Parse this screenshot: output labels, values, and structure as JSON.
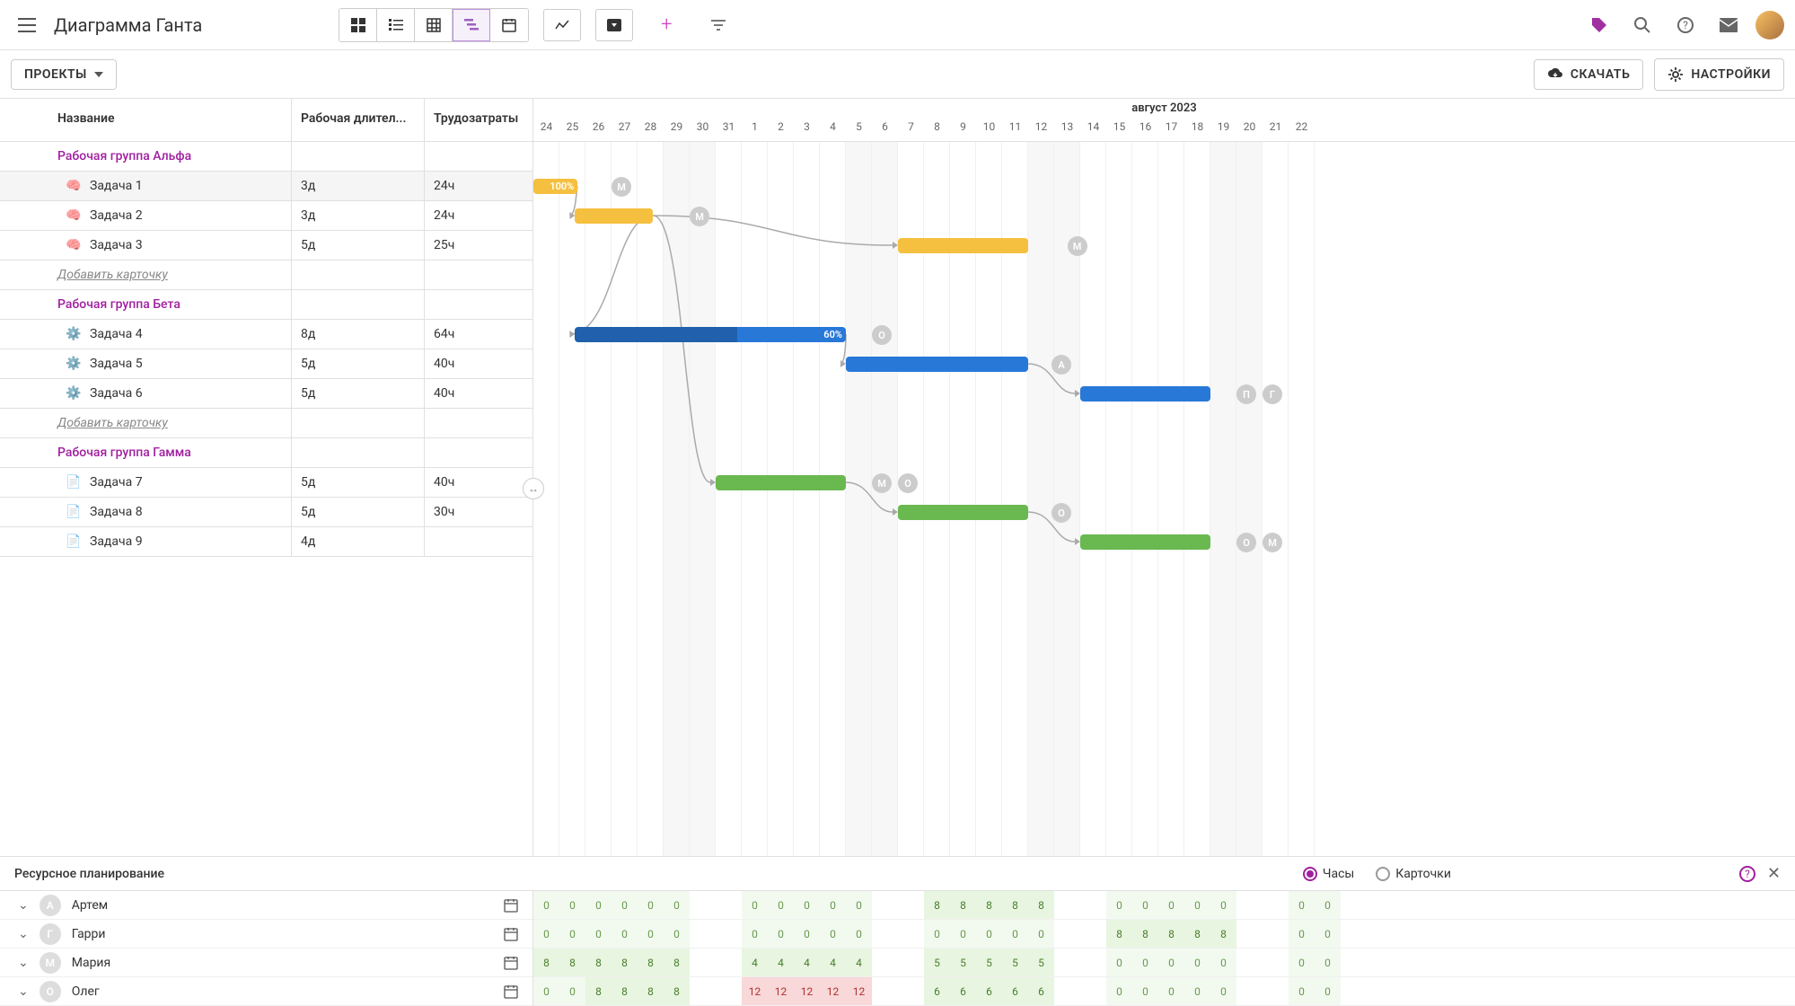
{
  "header": {
    "page_title": "Диаграмма Ганта"
  },
  "subbar": {
    "projects_label": "ПРОЕКТЫ",
    "download_label": "СКАЧАТЬ",
    "settings_label": "НАСТРОЙКИ"
  },
  "columns": {
    "name": "Название",
    "duration": "Рабочая длител...",
    "work": "Трудозатраты"
  },
  "timeline": {
    "month_label": "август 2023",
    "days": [
      24,
      25,
      26,
      27,
      28,
      29,
      30,
      31,
      1,
      2,
      3,
      4,
      5,
      6,
      7,
      8,
      9,
      10,
      11,
      12,
      13,
      14,
      15,
      16,
      17,
      18,
      19,
      20,
      21,
      22
    ],
    "weekend_indices": [
      5,
      6,
      12,
      13,
      19,
      20,
      26,
      27
    ]
  },
  "groups": [
    {
      "name": "Рабочая группа Альфа",
      "tasks": [
        {
          "icon": "🧠",
          "name": "Задача 1",
          "duration": "3д",
          "work": "24ч",
          "start": 0,
          "len": 1.7,
          "color": "yellow",
          "progress_label": "100%",
          "assignees": [
            {
              "letter": "М",
              "offset": 3
            }
          ]
        },
        {
          "icon": "🧠",
          "name": "Задача 2",
          "duration": "3д",
          "work": "24ч",
          "start": 1.6,
          "len": 3,
          "color": "yellow",
          "assignees": [
            {
              "letter": "М",
              "offset": 6
            }
          ]
        },
        {
          "icon": "🧠",
          "name": "Задача 3",
          "duration": "5д",
          "work": "25ч",
          "start": 14,
          "len": 5,
          "color": "yellow",
          "assignees": [
            {
              "letter": "М",
              "offset": 20.5
            }
          ]
        }
      ],
      "add_label": "Добавить карточку"
    },
    {
      "name": "Рабочая группа Бета",
      "tasks": [
        {
          "icon": "⚙️",
          "name": "Задача 4",
          "duration": "8д",
          "work": "64ч",
          "start": 1.6,
          "len": 10.4,
          "color": "blue",
          "progress_label": "60%",
          "progress": 0.6,
          "assignees": [
            {
              "letter": "О",
              "offset": 13
            }
          ]
        },
        {
          "icon": "⚙️",
          "name": "Задача 5",
          "duration": "5д",
          "work": "40ч",
          "start": 12,
          "len": 7,
          "color": "blue",
          "assignees": [
            {
              "letter": "А",
              "offset": 19.9
            }
          ]
        },
        {
          "icon": "⚙️",
          "name": "Задача 6",
          "duration": "5д",
          "work": "40ч",
          "start": 21,
          "len": 5,
          "color": "blue",
          "assignees": [
            {
              "letter": "П",
              "offset": 27
            },
            {
              "letter": "Г",
              "offset": 28
            }
          ]
        }
      ],
      "add_label": "Добавить карточку"
    },
    {
      "name": "Рабочая группа Гамма",
      "tasks": [
        {
          "icon": "📄",
          "name": "Задача 7",
          "duration": "5д",
          "work": "40ч",
          "start": 7,
          "len": 5,
          "color": "green",
          "assignees": [
            {
              "letter": "М",
              "offset": 13
            },
            {
              "letter": "О",
              "offset": 14
            }
          ]
        },
        {
          "icon": "📄",
          "name": "Задача 8",
          "duration": "5д",
          "work": "30ч",
          "start": 14,
          "len": 5,
          "color": "green",
          "assignees": [
            {
              "letter": "О",
              "offset": 19.9
            }
          ]
        },
        {
          "icon": "📄",
          "name": "Задача 9",
          "duration": "4д",
          "work": "",
          "start": 21,
          "len": 5,
          "color": "green",
          "assignees": [
            {
              "letter": "О",
              "offset": 27
            },
            {
              "letter": "М",
              "offset": 28
            }
          ]
        }
      ]
    }
  ],
  "resource": {
    "title": "Ресурсное планирование",
    "radio_hours": "Часы",
    "radio_cards": "Карточки",
    "people": [
      {
        "letter": "А",
        "name": "Артем",
        "hours": [
          0,
          0,
          0,
          0,
          0,
          0,
          null,
          null,
          0,
          0,
          0,
          0,
          0,
          null,
          null,
          8,
          8,
          8,
          8,
          8,
          null,
          null,
          0,
          0,
          0,
          0,
          0,
          null,
          null,
          0,
          0
        ]
      },
      {
        "letter": "Г",
        "name": "Гарри",
        "hours": [
          0,
          0,
          0,
          0,
          0,
          0,
          null,
          null,
          0,
          0,
          0,
          0,
          0,
          null,
          null,
          0,
          0,
          0,
          0,
          0,
          null,
          null,
          8,
          8,
          8,
          8,
          8,
          null,
          null,
          0,
          0
        ]
      },
      {
        "letter": "М",
        "name": "Мария",
        "hours": [
          8,
          8,
          8,
          8,
          8,
          8,
          null,
          null,
          4,
          4,
          4,
          4,
          4,
          null,
          null,
          5,
          5,
          5,
          5,
          5,
          null,
          null,
          0,
          0,
          0,
          0,
          0,
          null,
          null,
          0,
          0
        ]
      },
      {
        "letter": "О",
        "name": "Олег",
        "hours": [
          0,
          0,
          8,
          8,
          8,
          8,
          null,
          null,
          12,
          12,
          12,
          12,
          12,
          null,
          null,
          6,
          6,
          6,
          6,
          6,
          null,
          null,
          0,
          0,
          0,
          0,
          0,
          null,
          null,
          0,
          0
        ]
      }
    ]
  }
}
